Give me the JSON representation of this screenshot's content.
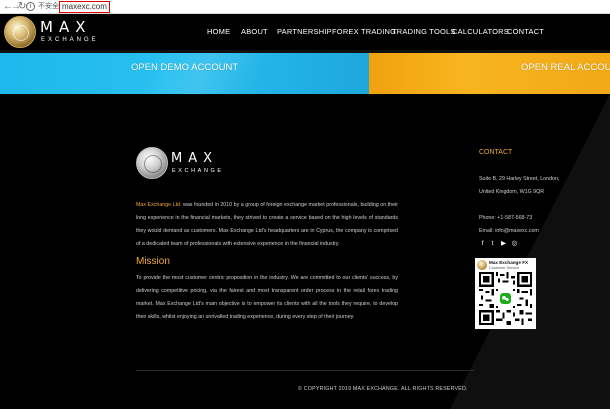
{
  "browser": {
    "back_glyph": "←",
    "forward_glyph": "→",
    "reload_glyph": "↻",
    "info_glyph": "i",
    "security_label": "不安全",
    "url": "maxexc.com"
  },
  "brand": {
    "name": "MAX",
    "sub": "EXCHANGE"
  },
  "nav": {
    "items": [
      "HOME",
      "ABOUT",
      "PARTNERSHIP",
      "FOREX TRADING",
      "TRADING TOOLS",
      "CALCULATORS",
      "CONTACT"
    ]
  },
  "banner": {
    "demo_label": "OPEN DEMO ACCOUNT",
    "real_label": "OPEN REAL ACCOUNT",
    "demo_color": "#27c0f0",
    "real_color": "#f7b51f"
  },
  "about": {
    "company": "Max Exchange Ltd.",
    "text": " was founded in 2010 by a group of foreign exchange market professionals, building on their long experience in the financial markets, they strived to create a service based on the high levels of standards they would demand as customers. Max Exchange Ltd's headquarters are in Cyprus, the company is comprised of a dedicated team of professionals with extensive experience in the financial industry."
  },
  "mission": {
    "title": "Mission",
    "text": "To provide the most customer centric proposition in the industry. We are committed to our clients' success, by delivering competitive pricing, via the fairest and most transparent order process in the retail forex trading market. Max Exchange Ltd's main objective is to empower its clients with all the tools they require, to develop their skills, whilst enjoying an unrivalled trading experience, during every step of their journey."
  },
  "contact": {
    "title": "CONTACT",
    "address_line1": "Suite B, 29 Harley Street, London,",
    "address_line2": "United Kingdom, W1G 9QR",
    "phone": "Phone: +1-587-568-73",
    "email": "Email: info@maxexc.com"
  },
  "social": {
    "icons": [
      "facebook-icon",
      "twitter-icon",
      "youtube-icon",
      "instagram-icon"
    ],
    "glyphs": [
      "f",
      "t",
      "▶",
      "◎"
    ]
  },
  "wechat": {
    "name": "Max Exchange FX",
    "sub": "Customer Service",
    "center_color": "#1aad19"
  },
  "footer": {
    "copyright": "© COPYRIGHT 2019 MAX EXCHANGE. ALL RIGHTS RESERVED."
  },
  "colors": {
    "accent": "#f0a832",
    "background": "#000000"
  }
}
